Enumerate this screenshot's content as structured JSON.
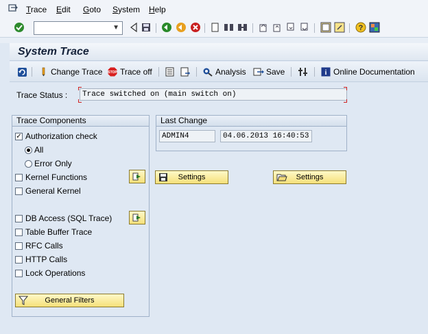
{
  "menu": {
    "items": [
      "Trace",
      "Edit",
      "Goto",
      "System",
      "Help"
    ]
  },
  "toolbar": {
    "command_value": ""
  },
  "title": "System Trace",
  "app_toolbar": {
    "change_trace": "Change Trace",
    "trace_off": "Trace off",
    "analysis": "Analysis",
    "save": "Save",
    "online_doc": "Online Documentation"
  },
  "trace_status": {
    "label": "Trace Status :",
    "value": "Trace switched on (main switch on)"
  },
  "components": {
    "header": "Trace Components",
    "authorization_check": "Authorization check",
    "all": "All",
    "error_only": "Error Only",
    "kernel_functions": "Kernel Functions",
    "general_kernel": "General Kernel",
    "db_access": "DB Access (SQL Trace)",
    "table_buffer": "Table Buffer Trace",
    "rfc_calls": "RFC Calls",
    "http_calls": "HTTP Calls",
    "lock_operations": "Lock Operations",
    "general_filters": "General Filters"
  },
  "last_change": {
    "header": "Last Change",
    "user": "ADMIN4",
    "datetime": "04.06.2013 16:40:53"
  },
  "settings_label_1": "Settings",
  "settings_label_2": "Settings",
  "colors": {
    "background": "#dfe8f3",
    "button_yellow": "#f5e07a",
    "trace_off_red": "#d82020"
  }
}
